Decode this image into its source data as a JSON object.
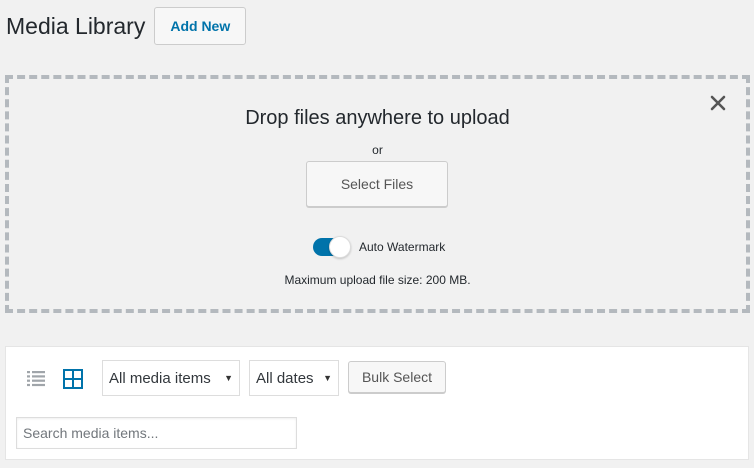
{
  "header": {
    "title": "Media Library",
    "add_new_label": "Add New"
  },
  "uploader": {
    "drop_title": "Drop files anywhere to upload",
    "or_text": "or",
    "select_files_label": "Select Files",
    "watermark_label": "Auto Watermark",
    "watermark_enabled": true,
    "max_size_text": "Maximum upload file size: 200 MB.",
    "close_icon": "close-icon"
  },
  "toolbar": {
    "view_list_icon": "list-view-icon",
    "view_grid_icon": "grid-view-icon",
    "active_view": "grid",
    "media_filter": "All media items",
    "date_filter": "All dates",
    "bulk_select_label": "Bulk Select",
    "search_placeholder": "Search media items..."
  },
  "colors": {
    "accent": "#0073aa",
    "background": "#f1f1f1",
    "dashed_border": "#b4b9be"
  }
}
